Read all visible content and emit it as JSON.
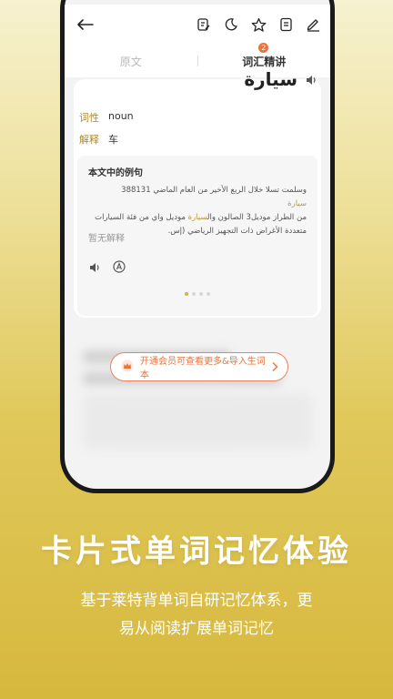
{
  "topbar": {
    "icons": [
      "back-arrow-icon",
      "edit-note-icon",
      "moon-icon",
      "star-icon",
      "document-icon",
      "pen-icon"
    ]
  },
  "tabs": [
    {
      "label": "原文",
      "active": false
    },
    {
      "label": "词汇精讲",
      "active": true,
      "badge": "2"
    }
  ],
  "word": {
    "text": "سيارة",
    "pos_label": "词性",
    "pos_value": "noun",
    "meaning_label": "解释",
    "meaning_value": "车"
  },
  "example": {
    "title": "本文中的例句",
    "line1": "وسلمت تسلا خلال الربع الأخير من العام الماضي 388131",
    "line1_hl": "سيارة",
    "line2": "من الطراز موديل3 الصالون وال",
    "line2_hl": "سيارة",
    "line2_rest": "موديل واي من فئة السيارات",
    "line3": "متعددة الأغراض ذات التجهيز الرياضي (إس.",
    "none_text": "暂无解释"
  },
  "pager": {
    "count": 4,
    "active": 0
  },
  "vip_button": {
    "label": "开通会员可查看更多&导入生词本"
  },
  "headline": "卡片式单词记忆体验",
  "subline1": "基于莱特背单词自研记忆体系，更",
  "subline2": "易从阅读扩展单词记忆",
  "colors": {
    "accent": "#e9733e",
    "gold": "#a78b2e"
  }
}
